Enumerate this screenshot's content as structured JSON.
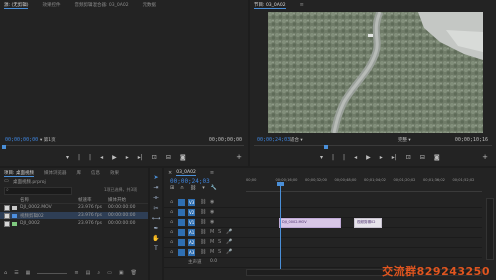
{
  "source_monitor": {
    "tabs": [
      "源: (无剪辑)",
      "效果控件",
      "音频剪辑混合器: 03_0A02",
      "元数据"
    ],
    "timecode_left": "00;00;00;00",
    "page_select": "第1页",
    "timecode_right": "00;00;00;00"
  },
  "program_monitor": {
    "tab": "节目: 03_0A02",
    "timecode_left": "00;00;24;03",
    "fit": "适合",
    "quality": "完整",
    "timecode_right": "00;00;10;16"
  },
  "project_panel": {
    "tabs": [
      "项目: 桌面视频",
      "媒体浏览器",
      "库",
      "信息",
      "效果"
    ],
    "project_name": "桌面视频.prproj",
    "selection_info": "1项已选择，共3项",
    "columns": [
      "名称",
      "帧速率",
      "媒体开始"
    ],
    "items": [
      {
        "name": "DJI_0002.MOV",
        "fps": "23.976 fps",
        "start": "00:00:00:00",
        "color": "#c9c9c9"
      },
      {
        "name": "视频剪辑02",
        "fps": "23.976 fps",
        "start": "00:00:00:00",
        "color": "#4d8fe0"
      },
      {
        "name": "DJI_0002",
        "fps": "23.976 fps",
        "start": "00:00:00:00",
        "color": "#7fc97f"
      }
    ]
  },
  "timeline": {
    "tab": "03_0A02",
    "timecode": "00;00;24;03",
    "ruler_labels": [
      "00;00",
      "00;00;16;00",
      "00;00;32;00",
      "00;00;48;00",
      "00;01;04;02",
      "00;01;20;02",
      "00;01;36;02",
      "00;01;52;02"
    ],
    "video_tracks": [
      "V3",
      "V2",
      "V1"
    ],
    "audio_tracks": [
      "A1",
      "A2",
      "A3"
    ],
    "master_label": "主声道",
    "master_value": "0.0",
    "clip_1_label": "DJI_0002.MOV",
    "clip_2_label": "视频剪辑02"
  },
  "watermark": "交流群829243250"
}
